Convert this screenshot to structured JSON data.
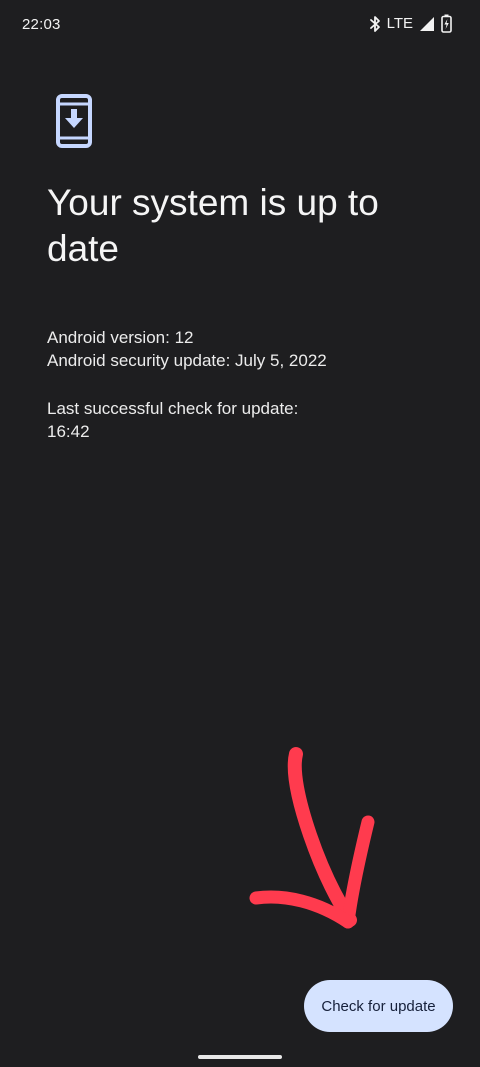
{
  "status_bar": {
    "time": "22:03",
    "network": "LTE",
    "icons": [
      "bluetooth-icon",
      "signal-icon",
      "battery-charging-icon"
    ]
  },
  "header": {
    "icon": "system-update-icon",
    "title": "Your system is up to date"
  },
  "info": {
    "android_version": "Android version: 12",
    "security_update": "Android security update: July 5, 2022",
    "last_check_label": "Last successful check for update:",
    "last_check_time": "16:42"
  },
  "actions": {
    "check_button_label": "Check for update"
  },
  "colors": {
    "background": "#1e1e20",
    "accent": "#d5e3ff",
    "icon": "#c6d7ff",
    "annotation": "#ff3b4e"
  }
}
